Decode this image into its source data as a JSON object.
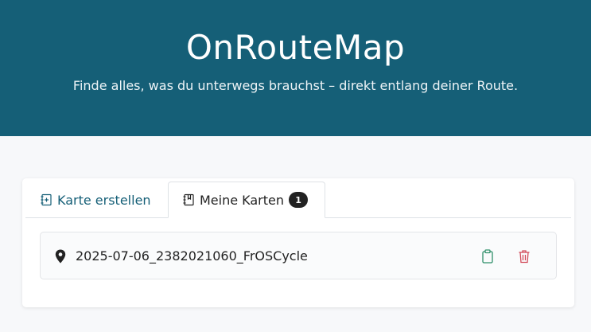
{
  "header": {
    "title": "OnRouteMap",
    "subtitle": "Finde alles, was du unterwegs brauchst – direkt entlang deiner Route."
  },
  "tabs": [
    {
      "label": "Karte erstellen",
      "icon": "add-map-icon",
      "active": false
    },
    {
      "label": "Meine Karten",
      "icon": "my-maps-icon",
      "active": true,
      "badge": "1"
    }
  ],
  "maps": [
    {
      "name": "2025-07-06_2382021060_FrOSCycle",
      "icon": "map-pin-icon"
    }
  ],
  "colors": {
    "header_bg": "#155f77",
    "accent": "#155f77",
    "copy_icon": "#2f8f6a",
    "delete_icon": "#d24b5a",
    "badge_bg": "#222222"
  }
}
